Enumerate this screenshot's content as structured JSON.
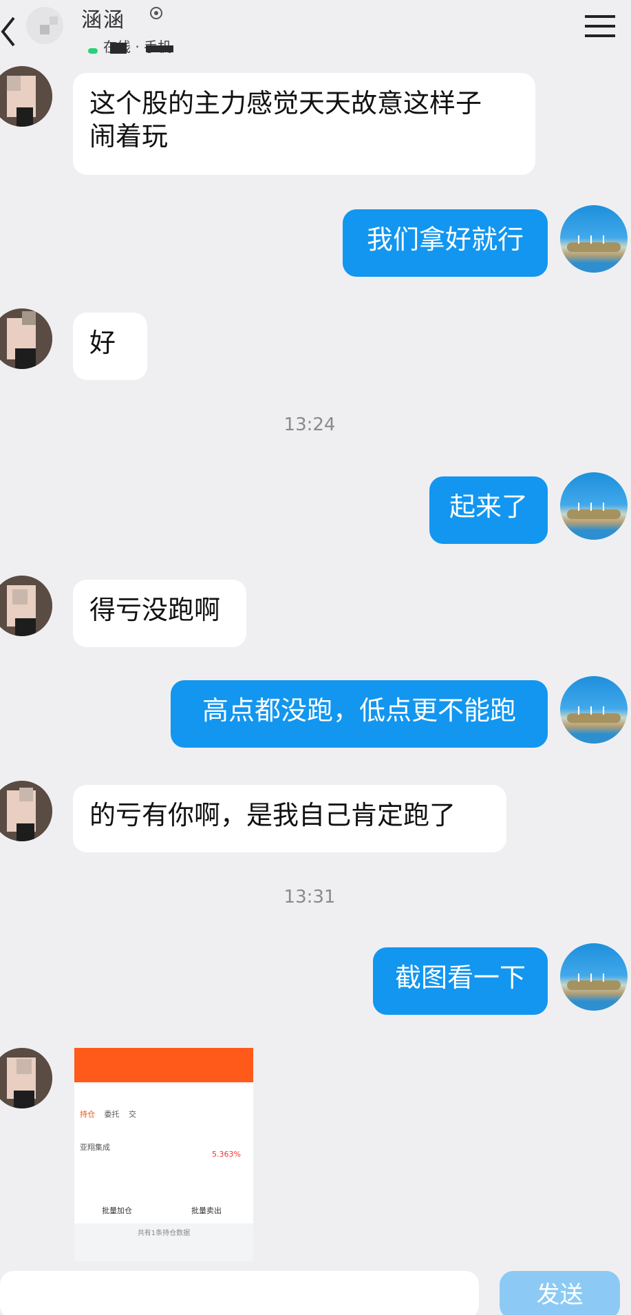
{
  "header": {
    "title": "涵涵",
    "subtitle": "在线 · 手机"
  },
  "messages": [
    {
      "side": "left",
      "text_line1": "这个股的主力感觉天天故意这样子",
      "text_line2": "闹着玩"
    },
    {
      "side": "right",
      "text": "我们拿好就行"
    },
    {
      "side": "left",
      "text": "好"
    },
    {
      "type": "time",
      "text": "13:24"
    },
    {
      "side": "right",
      "text": "起来了"
    },
    {
      "side": "left",
      "text": "得亏没跑啊"
    },
    {
      "side": "right",
      "text": "高点都没跑，低点更不能跑"
    },
    {
      "side": "left",
      "text": "的亏有你啊，是我自己肯定跑了"
    },
    {
      "type": "time",
      "text": "13:31"
    },
    {
      "side": "right",
      "text": "截图看一下"
    }
  ],
  "image_message": {
    "tab_hold": "持仓",
    "tab_entrust": "委托",
    "tab_deal": "交",
    "stock_name": "亚翔集成",
    "pct": "5.363%",
    "btn_add": "批量加仓",
    "btn_sell": "批量卖出",
    "footer": "共有1条持仓数据"
  },
  "input": {
    "placeholder": "",
    "send_label": "发送"
  },
  "colors": {
    "bubble_right": "#1296f0",
    "bubble_left": "#ffffff",
    "background": "#efeff2"
  }
}
